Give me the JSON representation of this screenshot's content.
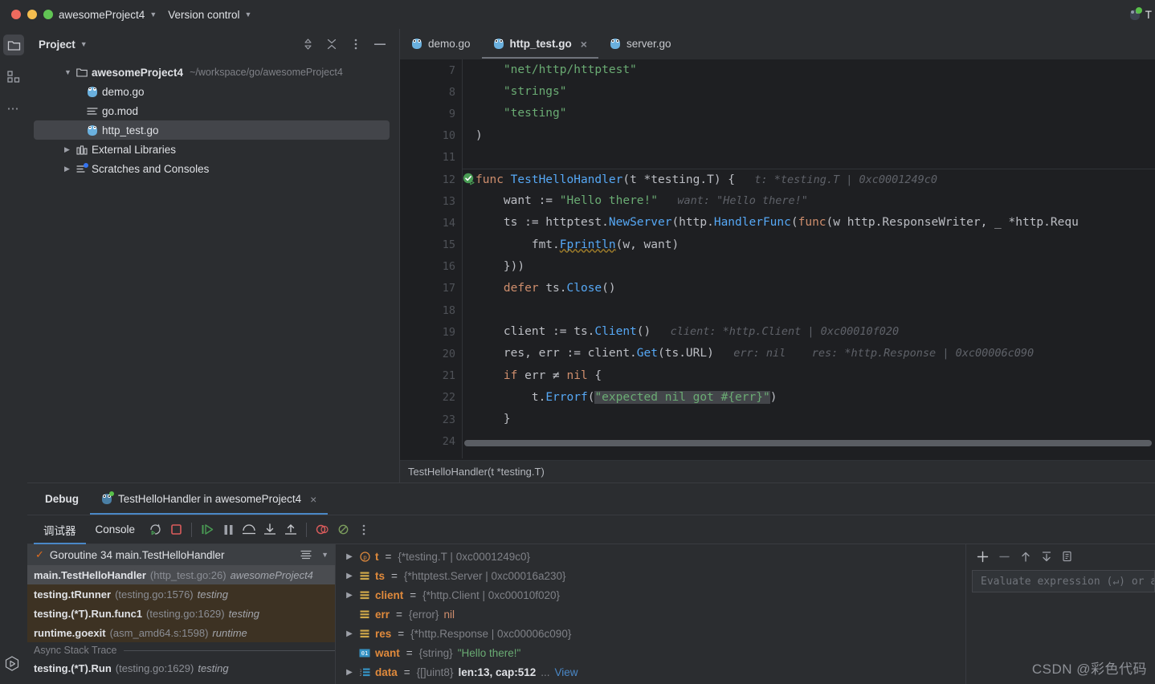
{
  "titlebar": {
    "project_name": "awesomeProject4",
    "version_control": "Version control",
    "right_label": "T"
  },
  "rail": {
    "project_icon": "folder-icon",
    "structure_icon": "structure-icon",
    "more_icon": "more-icon",
    "run_icon": "run-icon"
  },
  "project_panel": {
    "title": "Project",
    "actions": [
      "sort-icon",
      "collapse-all-icon",
      "options-icon",
      "hide-icon"
    ],
    "tree": [
      {
        "label": "awesomeProject4",
        "path": "~/workspace/go/awesomeProject4",
        "icon": "folder-icon",
        "level": 0,
        "expanded": true,
        "selected": false
      },
      {
        "label": "demo.go",
        "path": "",
        "icon": "go-file-icon",
        "level": 1,
        "expanded": null,
        "selected": false
      },
      {
        "label": "go.mod",
        "path": "",
        "icon": "modfile-icon",
        "level": 1,
        "expanded": null,
        "selected": false
      },
      {
        "label": "http_test.go",
        "path": "",
        "icon": "go-file-icon",
        "level": 1,
        "expanded": null,
        "selected": true
      },
      {
        "label": "External Libraries",
        "path": "",
        "icon": "library-icon",
        "level": 0,
        "expanded": false,
        "selected": false
      },
      {
        "label": "Scratches and Consoles",
        "path": "",
        "icon": "scratches-icon",
        "level": 0,
        "expanded": false,
        "selected": false
      }
    ]
  },
  "editor": {
    "tabs": [
      {
        "label": "demo.go",
        "icon": "go-file-icon",
        "active": false,
        "closable": false
      },
      {
        "label": "http_test.go",
        "icon": "go-file-icon",
        "active": true,
        "closable": true
      },
      {
        "label": "server.go",
        "icon": "go-file-icon",
        "active": false,
        "closable": false
      }
    ],
    "close_glyph": "×",
    "first_visible_line": 7,
    "line_numbers": [
      7,
      8,
      9,
      10,
      11,
      12,
      13,
      14,
      15,
      16,
      17,
      18,
      19,
      20,
      21,
      22,
      23,
      24
    ],
    "run_gutter_line": 12,
    "breadcrumb": "TestHelloHandler(t *testing.T)",
    "code_text": [
      "    \"net/http/httptest\"",
      "    \"strings\"",
      "    \"testing\"",
      ")",
      "",
      "func TestHelloHandler(t *testing.T) {   t: *testing.T | 0xc0001249c0",
      "    want := \"Hello there!\"   want: \"Hello there!\"",
      "    ts := httptest.NewServer(http.HandlerFunc(func(w http.ResponseWriter, _ *http.Requ",
      "        fmt.Fprintln(w, want)",
      "    }))",
      "    defer ts.Close()",
      "",
      "    client := ts.Client()   client: *http.Client | 0xc00010f020",
      "    res, err := client.Get(ts.URL)   err: nil    res: *http.Response | 0xc00006c090",
      "    if err ≠ nil {",
      "        t.Errorf(\"expected nil got #{err}\")",
      "    }",
      ""
    ],
    "inline_hints": [
      "t: *testing.T | 0xc0001249c0",
      "want: \"Hello there!\"",
      "client: *http.Client | 0xc00010f020",
      "err: nil",
      "res: *http.Response | 0xc00006c090"
    ]
  },
  "debug": {
    "panel_title": "Debug",
    "session_tab": "TestHelloHandler in awesomeProject4",
    "session_close": "×",
    "subtabs": [
      {
        "label": "调试器",
        "active": true
      },
      {
        "label": "Console",
        "active": false
      }
    ],
    "toolbar_buttons": [
      "rerun-icon",
      "stop-icon",
      "resume-icon",
      "pause-icon",
      "step-over-icon",
      "step-into-icon",
      "step-out-icon",
      "view-breakpoints-icon",
      "mute-breakpoints-icon",
      "more-icon"
    ],
    "goroutine_selector": "Goroutine 34 main.TestHelloHandler",
    "frames": [
      {
        "name": "main.TestHelloHandler",
        "location": "(http_test.go:26)",
        "module": "awesomeProject4",
        "selected": true
      },
      {
        "name": "testing.tRunner",
        "location": "(testing.go:1576)",
        "module": "testing",
        "selected": false
      },
      {
        "name": "testing.(*T).Run.func1",
        "location": "(testing.go:1629)",
        "module": "testing",
        "selected": false
      },
      {
        "name": "runtime.goexit",
        "location": "(asm_amd64.s:1598)",
        "module": "runtime",
        "selected": false
      }
    ],
    "async_separator": "Async Stack Trace",
    "async_frames": [
      {
        "name": "testing.(*T).Run",
        "location": "(testing.go:1629)",
        "module": "testing",
        "selected": false
      }
    ],
    "variables": [
      {
        "expandable": true,
        "icon": "param-icon",
        "name": "t",
        "type": "{*testing.T | 0xc0001249c0}",
        "value": "",
        "kind": "type"
      },
      {
        "expandable": true,
        "icon": "object-icon",
        "name": "ts",
        "type": "{*httptest.Server | 0xc00016a230}",
        "value": "",
        "kind": "type"
      },
      {
        "expandable": true,
        "icon": "object-icon",
        "name": "client",
        "type": "{*http.Client | 0xc00010f020}",
        "value": "",
        "kind": "type"
      },
      {
        "expandable": false,
        "icon": "object-icon",
        "name": "err",
        "type": "{error}",
        "value": "nil",
        "kind": "nil"
      },
      {
        "expandable": true,
        "icon": "object-icon",
        "name": "res",
        "type": "{*http.Response | 0xc00006c090}",
        "value": "",
        "kind": "type"
      },
      {
        "expandable": false,
        "icon": "string-icon",
        "name": "want",
        "type": "{string}",
        "value": "\"Hello there!\"",
        "kind": "str"
      },
      {
        "expandable": true,
        "icon": "array-icon",
        "name": "data",
        "type": "{[]uint8}",
        "value": "len:13, cap:512",
        "kind": "num",
        "suffix": "...",
        "link": "View"
      }
    ],
    "watches": {
      "toolbar": [
        "add-icon",
        "remove-icon",
        "up-icon",
        "down-icon",
        "copy-icon"
      ],
      "evaluate_placeholder": "Evaluate expression (↵) or a"
    }
  },
  "watermark": "CSDN @彩色代码",
  "colors": {
    "accent_blue": "#4a88c7",
    "selection": "#43454a",
    "frame_highlight": "#3d3223",
    "editor_bg": "#1e1f22",
    "panel_bg": "#2b2d30",
    "string_green": "#6aab73",
    "keyword_orange": "#cf8e6d",
    "func_blue": "#56a8f5",
    "var_orange": "#e08a3c"
  }
}
